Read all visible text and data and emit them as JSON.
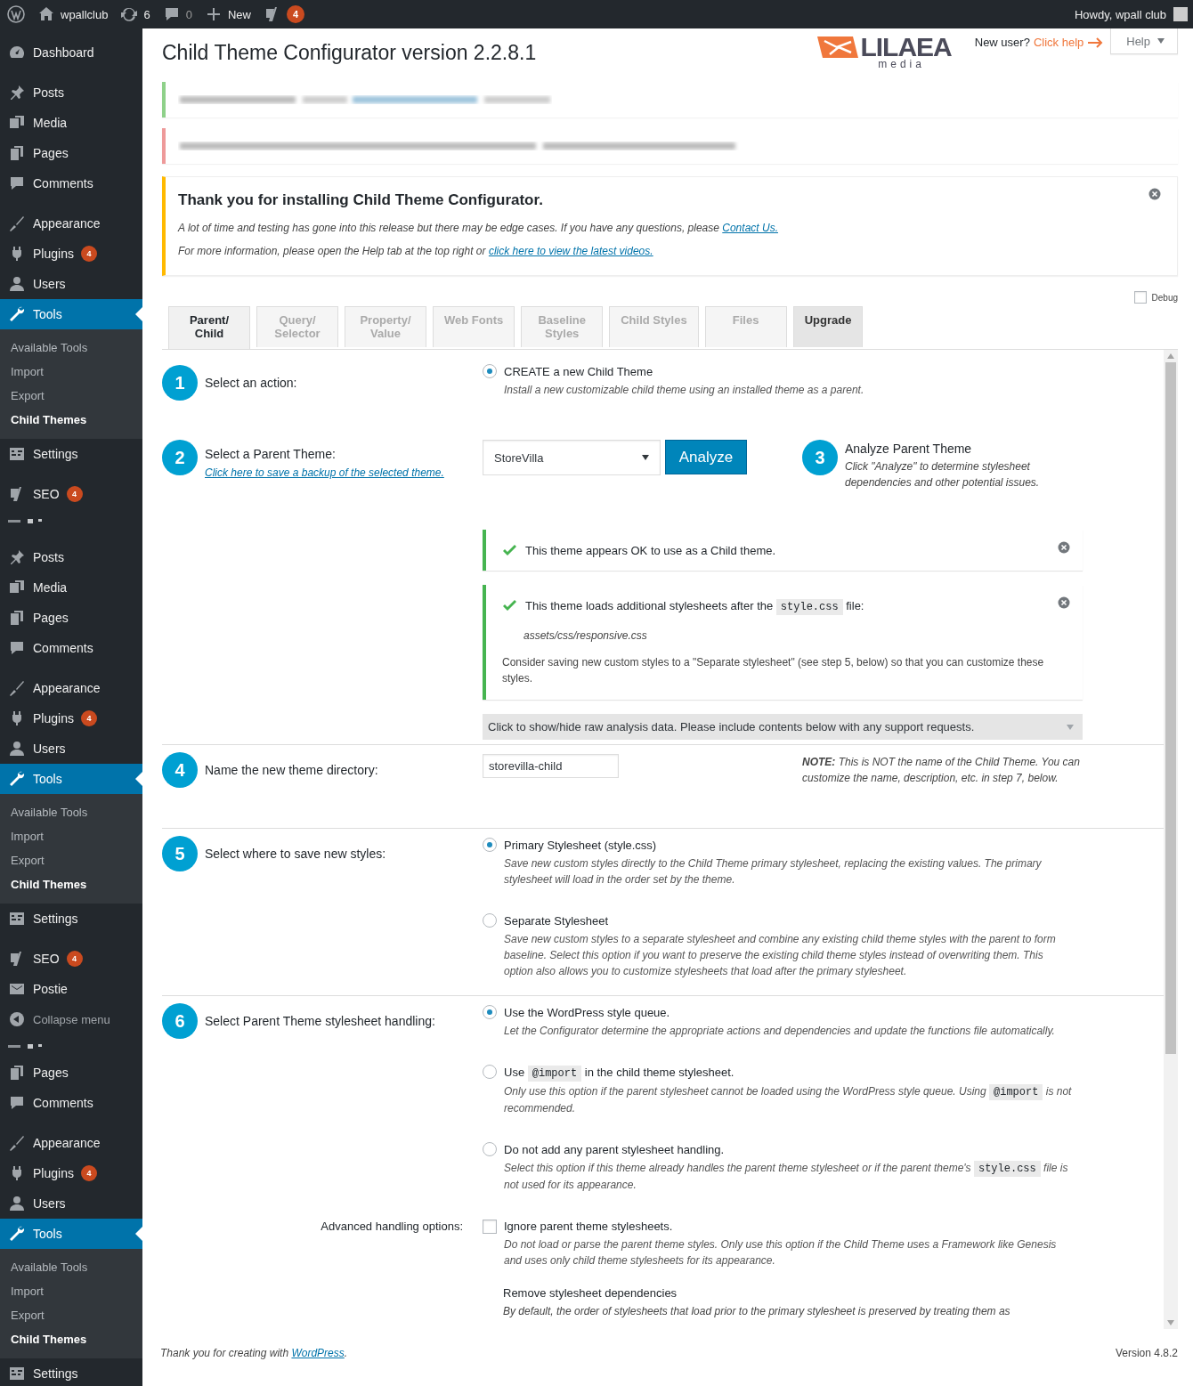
{
  "admin_bar": {
    "site": "wpallclub",
    "updates": "6",
    "comments": "0",
    "new": "New",
    "seo_badge": "4",
    "greeting": "Howdy, wpall club"
  },
  "sidebar": {
    "sections": [
      {
        "items": [
          {
            "kind": "menu",
            "label": "Dashboard",
            "selected": false
          }
        ]
      },
      {
        "items": [
          {
            "kind": "menu",
            "label": "Posts",
            "selected": false
          },
          {
            "kind": "menu",
            "label": "Media",
            "selected": false
          },
          {
            "kind": "menu",
            "label": "Pages",
            "selected": false
          },
          {
            "kind": "menu",
            "label": "Comments",
            "selected": false
          }
        ]
      },
      {
        "items": [
          {
            "kind": "menu",
            "label": "Appearance",
            "selected": false
          },
          {
            "kind": "menu",
            "label": "Plugins",
            "badge": "4",
            "selected": false
          },
          {
            "kind": "menu",
            "label": "Users",
            "selected": false
          },
          {
            "kind": "menu",
            "label": "Tools",
            "selected": true,
            "children": [
              {
                "label": "Available Tools",
                "selected": false
              },
              {
                "label": "Import",
                "selected": false
              },
              {
                "label": "Export",
                "selected": false
              },
              {
                "label": "Child Themes",
                "selected": true
              }
            ]
          },
          {
            "kind": "menu",
            "label": "Settings",
            "selected": false
          }
        ]
      },
      {
        "items": [
          {
            "kind": "menu",
            "label": "SEO",
            "badge": "4",
            "selected": false
          },
          {
            "kind": "fragment"
          }
        ]
      },
      {
        "items": [
          {
            "kind": "menu",
            "label": "Posts",
            "selected": false
          },
          {
            "kind": "menu",
            "label": "Media",
            "selected": false
          },
          {
            "kind": "menu",
            "label": "Pages",
            "selected": false
          },
          {
            "kind": "menu",
            "label": "Comments",
            "selected": false
          }
        ]
      },
      {
        "items": [
          {
            "kind": "menu",
            "label": "Appearance",
            "selected": false
          },
          {
            "kind": "menu",
            "label": "Plugins",
            "badge": "4",
            "selected": false
          },
          {
            "kind": "menu",
            "label": "Users",
            "selected": false
          },
          {
            "kind": "menu",
            "label": "Tools",
            "selected": true,
            "children": [
              {
                "label": "Available Tools",
                "selected": false
              },
              {
                "label": "Import",
                "selected": false
              },
              {
                "label": "Export",
                "selected": false
              },
              {
                "label": "Child Themes",
                "selected": true
              }
            ]
          },
          {
            "kind": "menu",
            "label": "Settings",
            "selected": false
          }
        ]
      },
      {
        "items": [
          {
            "kind": "menu",
            "label": "SEO",
            "badge": "4",
            "selected": false
          },
          {
            "kind": "menu",
            "label": "Postie",
            "selected": false
          },
          {
            "kind": "collapse",
            "label": "Collapse menu",
            "selected": false
          },
          {
            "kind": "fragment"
          },
          {
            "kind": "menu",
            "label": "Pages",
            "selected": false
          },
          {
            "kind": "menu",
            "label": "Comments",
            "selected": false
          }
        ]
      },
      {
        "items": [
          {
            "kind": "menu",
            "label": "Appearance",
            "selected": false
          },
          {
            "kind": "menu",
            "label": "Plugins",
            "badge": "4",
            "selected": false
          },
          {
            "kind": "menu",
            "label": "Users",
            "selected": false
          },
          {
            "kind": "menu",
            "label": "Tools",
            "selected": true,
            "children": [
              {
                "label": "Available Tools",
                "selected": false
              },
              {
                "label": "Import",
                "selected": false
              },
              {
                "label": "Export",
                "selected": false
              },
              {
                "label": "Child Themes",
                "selected": true
              }
            ]
          },
          {
            "kind": "menu",
            "label": "Settings",
            "selected": false
          }
        ]
      }
    ]
  },
  "header": {
    "title": "Child Theme Configurator version 2.2.8.1",
    "logo": {
      "name": "LILAEA",
      "tagline": "media"
    },
    "help_prompt": "New user?",
    "help_link": "Click help",
    "help_button": "Help"
  },
  "blurred_notices": [
    {
      "color": "#8fd18a"
    },
    {
      "color": "#ee9a9a"
    }
  ],
  "welcome_notice": {
    "title": "Thank you for installing Child Theme Configurator.",
    "paragraphs": [
      [
        {
          "kind": "text",
          "text": "A lot of time and testing has gone into this release but there may be edge cases. If you have any questions, please "
        },
        {
          "kind": "link",
          "text": "Contact Us."
        }
      ],
      [
        {
          "kind": "text",
          "text": "For more information, please open the Help tab at the top right or "
        },
        {
          "kind": "link",
          "text": "click here to view the latest videos."
        }
      ]
    ]
  },
  "debug": {
    "label": "Debug",
    "checked": false
  },
  "tabs": [
    {
      "label": "Parent/\nChild",
      "kind": "tab",
      "selected": true
    },
    {
      "label": "Query/\nSelector",
      "kind": "tab",
      "selected": false
    },
    {
      "label": "Property/\nValue",
      "kind": "tab",
      "selected": false
    },
    {
      "label": "Web Fonts",
      "kind": "tab",
      "selected": false
    },
    {
      "label": "Baseline\nStyles",
      "kind": "tab",
      "selected": false
    },
    {
      "label": "Child Styles",
      "kind": "tab",
      "selected": false
    },
    {
      "label": "Files",
      "kind": "tab",
      "selected": false
    },
    {
      "label": "Upgrade",
      "kind": "upgrade",
      "selected": false
    }
  ],
  "action_step": {
    "number": "1",
    "label": "Select an action:",
    "option": {
      "label": "CREATE a new Child Theme",
      "description": "Install a new customizable child theme using an installed theme as a parent.",
      "selected": true
    }
  },
  "parent_step": {
    "number": "2",
    "label": "Select a Parent Theme:",
    "link": "Click here to save a backup of the selected theme.",
    "theme_select": "StoreVilla",
    "analyze_button": "Analyze",
    "analyze": {
      "number": "3",
      "title": "Analyze Parent Theme",
      "description": "Click \"Analyze\" to determine stylesheet dependencies and other potential issues."
    }
  },
  "analysis_notices": [
    {
      "message": "This theme appears OK to use as a Child theme."
    },
    {
      "message": [
        {
          "kind": "text",
          "text": "This theme loads additional stylesheets after the "
        },
        {
          "kind": "code",
          "text": "style.css"
        },
        {
          "kind": "text",
          "text": " file:"
        }
      ],
      "path": "assets/css/responsive.css",
      "note": "Consider saving new custom styles to a \"Separate stylesheet\" (see step 5, below) so that you can customize these styles."
    }
  ],
  "raw_data_toggle": "Click to show/hide raw analysis data. Please include contents below with any support requests.",
  "directory_step": {
    "number": "4",
    "label": "Name the new theme directory:",
    "value": "storevilla-child",
    "note": "**NOTE:** This is NOT the name of the Child Theme. You can customize the name, description, etc. in step 7, below."
  },
  "save_step": {
    "number": "5",
    "label": "Select where to save new styles:",
    "options": [
      {
        "label": "Primary Stylesheet (style.css)",
        "description": "Save new custom styles directly to the Child Theme primary stylesheet, replacing the existing values. The primary stylesheet will load in the order set by the theme.",
        "selected": true
      },
      {
        "label": "Separate Stylesheet",
        "description": "Save new custom styles to a separate stylesheet and combine any existing child theme styles with the parent to form baseline. Select this option if you want to preserve the existing child theme styles instead of overwriting them. This option also allows you to customize stylesheets that load after the primary stylesheet.",
        "selected": false
      }
    ]
  },
  "handling_step": {
    "number": "6",
    "label": "Select Parent Theme stylesheet handling:",
    "options": [
      {
        "label": "Use the WordPress style queue.",
        "description": "Let the Configurator determine the appropriate actions and dependencies and update the functions file automatically.",
        "selected": true
      },
      {
        "label": [
          {
            "kind": "text",
            "text": "Use "
          },
          {
            "kind": "code",
            "text": "@import"
          },
          {
            "kind": "text",
            "text": " in the child theme stylesheet."
          }
        ],
        "description": [
          {
            "kind": "text",
            "text": "Only use this option if the parent stylesheet cannot be loaded using the WordPress style queue. Using "
          },
          {
            "kind": "code",
            "text": "@import"
          },
          {
            "kind": "text",
            "text": " is not recommended."
          }
        ],
        "selected": false
      },
      {
        "label": "Do not add any parent stylesheet handling.",
        "description": [
          {
            "kind": "text",
            "text": "Select this option if this theme already handles the parent theme stylesheet or if the parent theme's "
          },
          {
            "kind": "code",
            "text": "style.css"
          },
          {
            "kind": "text",
            "text": " file is not used for its appearance."
          }
        ],
        "selected": false
      }
    ],
    "advanced": {
      "label": "Advanced handling options:",
      "checkbox": {
        "label": "Ignore parent theme stylesheets.",
        "description": "Do not load or parse the parent theme styles. Only use this option if the Child Theme uses a Framework like Genesis and uses only child theme stylesheets for its appearance.",
        "checked": false
      },
      "subheading": "Remove stylesheet dependencies",
      "text": "By default, the order of stylesheets that load prior to the primary stylesheet is preserved by treating them as"
    }
  },
  "footer": {
    "credit": [
      {
        "kind": "text",
        "text": "Thank you for creating with "
      },
      {
        "kind": "link",
        "text": "WordPress"
      },
      {
        "kind": "text",
        "text": "."
      }
    ],
    "version": "Version 4.8.2"
  }
}
